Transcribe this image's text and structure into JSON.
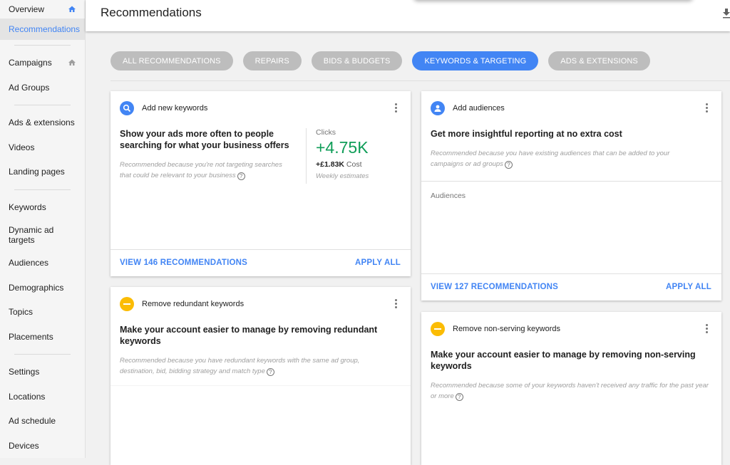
{
  "sidebar": {
    "items": [
      {
        "label": "Overview"
      },
      {
        "label": "Recommendations"
      },
      {
        "label": "Campaigns"
      },
      {
        "label": "Ad Groups"
      },
      {
        "label": "Ads & extensions"
      },
      {
        "label": "Videos"
      },
      {
        "label": "Landing pages"
      },
      {
        "label": "Keywords"
      },
      {
        "label": "Dynamic ad targets"
      },
      {
        "label": "Audiences"
      },
      {
        "label": "Demographics"
      },
      {
        "label": "Topics"
      },
      {
        "label": "Placements"
      },
      {
        "label": "Settings"
      },
      {
        "label": "Locations"
      },
      {
        "label": "Ad schedule"
      },
      {
        "label": "Devices"
      }
    ],
    "active": "Recommendations"
  },
  "header": {
    "title": "Recommendations"
  },
  "tabs": [
    {
      "label": "ALL RECOMMENDATIONS",
      "active": false
    },
    {
      "label": "REPAIRS",
      "active": false
    },
    {
      "label": "BIDS & BUDGETS",
      "active": false
    },
    {
      "label": "KEYWORDS & TARGETING",
      "active": true
    },
    {
      "label": "ADS & EXTENSIONS",
      "active": false
    }
  ],
  "cards": {
    "add_keywords": {
      "type": "Add new keywords",
      "title": "Show your ads more often to people searching for what your business offers",
      "reason": "Recommended because you're not targeting searches that could be relevant to your business",
      "stat_label": "Clicks",
      "stat_value": "+4.75K",
      "cost_value": "+£1.83K",
      "cost_label": "Cost",
      "note": "Weekly estimates",
      "view": "VIEW 146 RECOMMENDATIONS",
      "apply": "APPLY ALL"
    },
    "add_audiences": {
      "type": "Add audiences",
      "title": "Get more insightful reporting at no extra cost",
      "reason": "Recommended because you have existing audiences that can be added to your campaigns or ad groups",
      "section": "Audiences",
      "view": "VIEW 127 RECOMMENDATIONS",
      "apply": "APPLY ALL"
    },
    "remove_redundant": {
      "type": "Remove redundant keywords",
      "title": "Make your account easier to manage by removing redundant keywords",
      "reason": "Recommended because you have redundant keywords with the same ad group, destination, bid, bidding strategy and match type"
    },
    "remove_nonserving": {
      "type": "Remove non-serving keywords",
      "title": "Make your account easier to manage by removing non-serving keywords",
      "reason": "Recommended because some of your keywords haven't received any traffic for the past year or more"
    }
  },
  "colors": {
    "accent": "#4285f4",
    "positive": "#0f9d58",
    "warning": "#fbbc04"
  }
}
